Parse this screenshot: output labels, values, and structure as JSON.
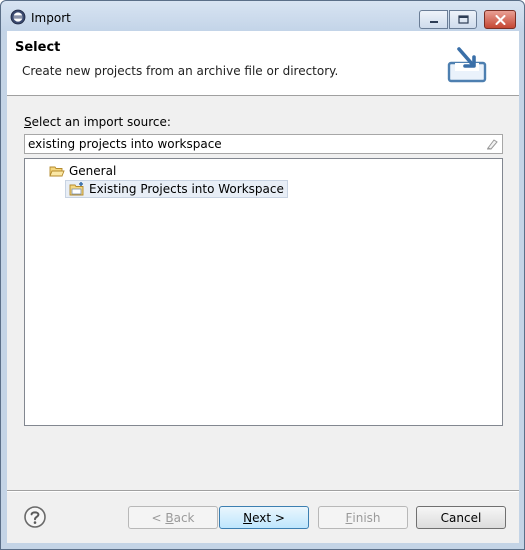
{
  "window": {
    "title": "Import"
  },
  "banner": {
    "title": "Select",
    "description": "Create new projects from an archive file or directory."
  },
  "source": {
    "label_mnemonic": "S",
    "label_rest": "elect an import source:",
    "filter_value": "existing projects into workspace"
  },
  "tree": {
    "items": [
      {
        "label": "General",
        "icon": "folder-open-icon",
        "level": 0
      },
      {
        "label": "Existing Projects into Workspace",
        "icon": "import-projects-icon",
        "level": 1
      }
    ]
  },
  "buttons": {
    "back_prefix": "< ",
    "back_mnemonic": "B",
    "back_rest": "ack",
    "next_mnemonic": "N",
    "next_rest": "ext >",
    "finish_mnemonic": "F",
    "finish_rest": "inish",
    "cancel": "Cancel"
  },
  "colors": {
    "titlebar": "#c3d4e8",
    "close_button": "#c54733",
    "default_button_border": "#3c7fb1",
    "dialog_background": "#f0f0f0"
  }
}
